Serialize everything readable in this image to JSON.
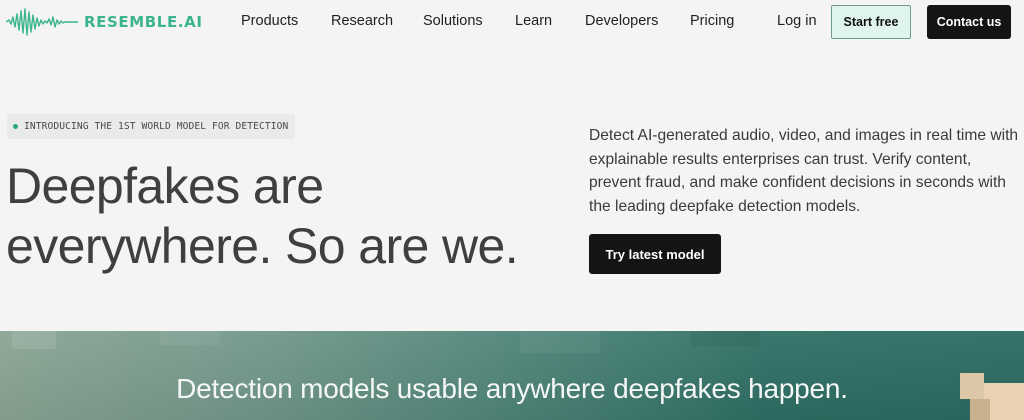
{
  "header": {
    "logo_text": "RESEMBLE.AI",
    "nav": [
      "Products",
      "Research",
      "Solutions",
      "Learn",
      "Developers",
      "Pricing"
    ],
    "login_label": "Log in",
    "start_label": "Start free",
    "contact_label": "Contact us"
  },
  "hero": {
    "badge": "INTRODUCING THE 1ST WORLD MODEL FOR DETECTION",
    "title_line1": "Deepfakes are",
    "title_line2": "everywhere. So are we.",
    "description": "Detect AI-generated audio, video, and images in real time with explainable results enterprises can trust. Verify content, prevent fraud, and make confident decisions in seconds with the leading deepfake detection models.",
    "cta_label": "Try latest model"
  },
  "band": {
    "heading": "Detection models usable anywhere deepfakes happen."
  },
  "colors": {
    "brand_green": "#3cb48f",
    "button_dark": "#141414",
    "start_button_bg": "#dff5ec",
    "band_teal": "#2e6e64",
    "page_bg": "#f4f4f3"
  }
}
